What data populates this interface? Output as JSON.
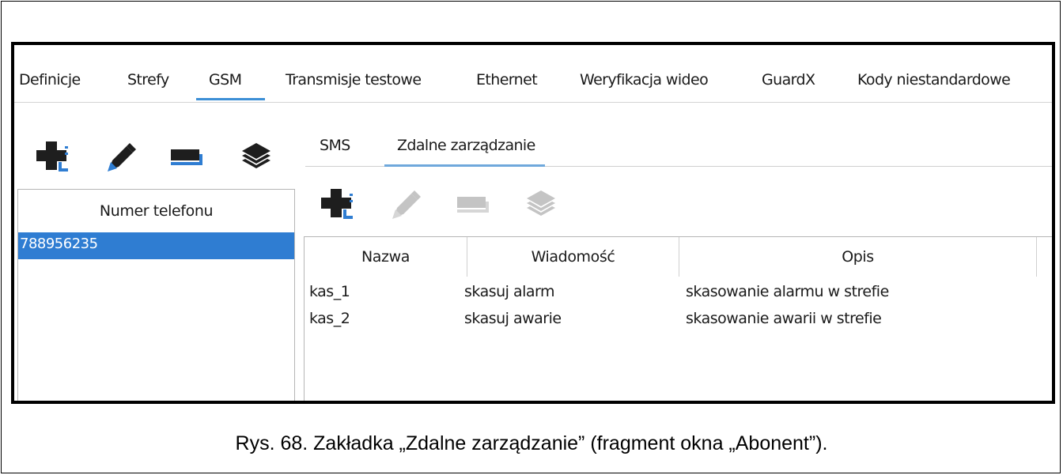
{
  "main_tabs": [
    {
      "label": "Definicje"
    },
    {
      "label": "Strefy"
    },
    {
      "label": "GSM",
      "active": true
    },
    {
      "label": "Transmisje testowe"
    },
    {
      "label": "Ethernet"
    },
    {
      "label": "Weryfikacja wideo"
    },
    {
      "label": "GuardX"
    },
    {
      "label": "Kody niestandardowe"
    }
  ],
  "left_panel": {
    "toolbar": [
      "add-icon",
      "edit-icon",
      "delete-icon",
      "layers-icon"
    ],
    "header": "Numer telefonu",
    "rows": [
      "788956235"
    ],
    "selected_row": "788956235"
  },
  "sub_tabs": [
    {
      "label": "SMS"
    },
    {
      "label": "Zdalne zarządzanie",
      "active": true
    }
  ],
  "right_panel": {
    "toolbar": [
      "add-icon",
      "edit-icon",
      "delete-icon",
      "layers-icon"
    ],
    "toolbar_state": "add enabled, others disabled",
    "columns": [
      "Nazwa",
      "Wiadomość",
      "Opis"
    ],
    "rows": [
      [
        "kas_1",
        "skasuj alarm",
        "skasowanie alarmu w strefie"
      ],
      [
        "kas_2",
        "skasuj awarie",
        "skasowanie awarii w strefie"
      ]
    ]
  },
  "caption": "Rys. 68. Zakładka „Zdalne zarządzanie” (fragment okna „Abonent”).",
  "colors": {
    "accent": "#2f7dd2",
    "tab_underline": "#3c8fd6",
    "icon_dark": "#1e1e1e",
    "icon_disabled": "#bdbdbd",
    "icon_blue": "#2f7dd2"
  }
}
